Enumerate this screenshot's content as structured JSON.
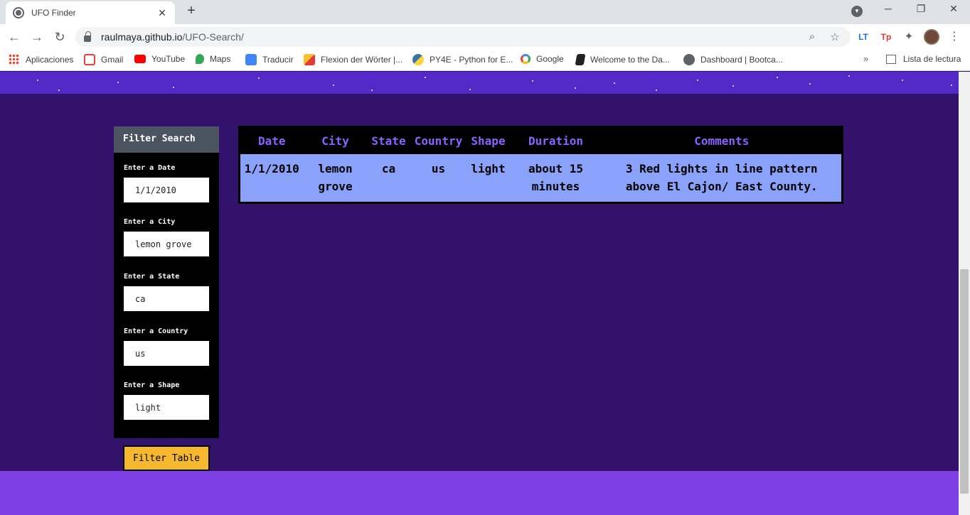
{
  "browser": {
    "tab_title": "UFO Finder",
    "tab_close": "✕",
    "new_tab": "+",
    "url_host": "raulmaya.github.io",
    "url_path": "/UFO-Search/",
    "bookmarks": [
      {
        "label": "Aplicaciones",
        "icon": "apps-grid-icon",
        "color": "#ea4335"
      },
      {
        "label": "Gmail",
        "icon": "gmail-icon",
        "color": "#ea4335"
      },
      {
        "label": "YouTube",
        "icon": "youtube-icon",
        "color": "#ff0000"
      },
      {
        "label": "Maps",
        "icon": "maps-icon",
        "color": "#34a853"
      },
      {
        "label": "Traducir",
        "icon": "translate-icon",
        "color": "#4285f4"
      },
      {
        "label": "Flexion der Wörter |...",
        "icon": "flexion-icon",
        "color": "#e53935"
      },
      {
        "label": "PY4E - Python for E...",
        "icon": "python-icon",
        "color": "#3776ab"
      },
      {
        "label": "Google",
        "icon": "google-icon",
        "color": "#4285f4"
      },
      {
        "label": "Welcome to the Da...",
        "icon": "book-icon",
        "color": "#202124"
      },
      {
        "label": "Dashboard | Bootca...",
        "icon": "globe-icon",
        "color": "#5f6368"
      }
    ],
    "bookmarks_more": "»",
    "reading_list": "Lista de lectura"
  },
  "filter": {
    "header": "Filter Search",
    "fields": [
      {
        "label": "Enter a Date",
        "value": "1/1/2010"
      },
      {
        "label": "Enter a City",
        "value": "lemon grove"
      },
      {
        "label": "Enter a State",
        "value": "ca"
      },
      {
        "label": "Enter a Country",
        "value": "us"
      },
      {
        "label": "Enter a Shape",
        "value": "light"
      }
    ],
    "button": "Filter Table"
  },
  "table": {
    "headers": [
      "Date",
      "City",
      "State",
      "Country",
      "Shape",
      "Duration",
      "Comments"
    ],
    "rows": [
      [
        "1/1/2010",
        "lemon grove",
        "ca",
        "us",
        "light",
        "about 15 minutes",
        "3 Red lights in line pattern above El Cajon/ East County."
      ]
    ]
  },
  "colors": {
    "page_bg": "#32126b",
    "header_band": "#532ac7",
    "footer": "#7e3fe4",
    "table_header_text": "#8a62ff",
    "table_row_bg": "#8aa2fa",
    "button_bg": "#f5b82e"
  }
}
